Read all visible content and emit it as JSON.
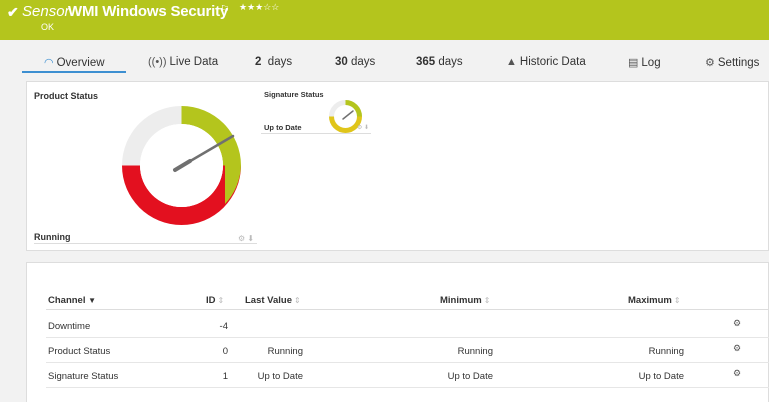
{
  "header": {
    "sensor_word": "Sensor",
    "title": "WMI Windows Security",
    "status": "OK",
    "stars": "★★★☆☆",
    "check_icon": "check-icon",
    "flag_icon": "flag-icon"
  },
  "tabs": [
    {
      "icon": "◠",
      "label": "Overview"
    },
    {
      "icon": "((•))",
      "label": "Live Data"
    },
    {
      "bold": "2",
      "label": "days"
    },
    {
      "bold": "30",
      "label": "days"
    },
    {
      "bold": "365",
      "label": "days"
    },
    {
      "icon": "▲",
      "label": "Historic Data"
    },
    {
      "icon": "▤",
      "label": "Log"
    },
    {
      "icon": "⚙",
      "label": "Settings"
    }
  ],
  "overview": {
    "product_gauge": {
      "title": "Product Status",
      "value_label": "Running"
    },
    "signature_gauge": {
      "title": "Signature Status",
      "value_label": "Up to Date"
    }
  },
  "table": {
    "headers": {
      "channel": "Channel",
      "id": "ID",
      "last_value": "Last Value",
      "minimum": "Minimum",
      "maximum": "Maximum"
    },
    "rows": [
      {
        "channel": "Downtime",
        "id": "-4",
        "last_value": "",
        "minimum": "",
        "maximum": ""
      },
      {
        "channel": "Product Status",
        "id": "0",
        "last_value": "Running",
        "minimum": "Running",
        "maximum": "Running"
      },
      {
        "channel": "Signature Status",
        "id": "1",
        "last_value": "Up to Date",
        "minimum": "Up to Date",
        "maximum": "Up to Date"
      }
    ]
  },
  "colors": {
    "header_bg": "#b4c51d",
    "gauge_green": "#b4c51d",
    "gauge_red": "#e3101f",
    "gauge_gray": "#ededed",
    "gauge_yellow": "#e0c51a",
    "tab_active": "#3d8fd1"
  }
}
